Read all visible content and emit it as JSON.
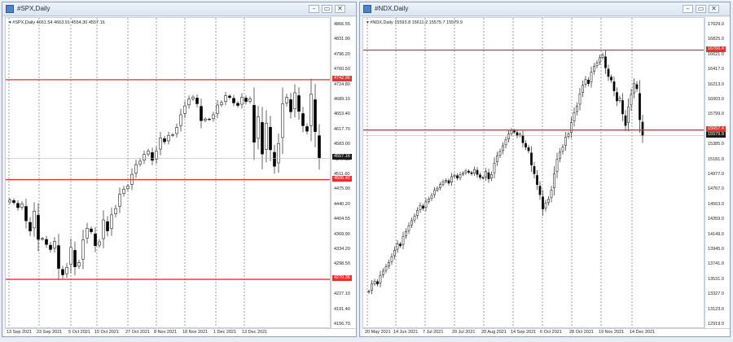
{
  "spx": {
    "title": "#SPX,Daily",
    "header": "▾ #SPX,Daily  4661.54 4663.91 4554.30 4557.16",
    "y_ticks": [
      "4866.55",
      "4831.90",
      "4796.20",
      "4760.50",
      "4724.80",
      "4689.10",
      "4653.40",
      "4617.70",
      "4583.00",
      "4547.30",
      "4511.60",
      "4475.90",
      "4440.20",
      "4404.55",
      "4369.90",
      "4334.20",
      "4298.50",
      "4262.80",
      "4227.10",
      "4191.40",
      "4156.70"
    ],
    "x_ticks": [
      "13 Sep 2021",
      "23 Sep 2021",
      "5 Oct 2021",
      "15 Oct 2021",
      "27 Oct 2021",
      "8 Nov 2021",
      "18 Nov 2021",
      "1 Dec 2021",
      "13 Dec 2021"
    ],
    "h_lines": [
      "4742.96",
      "4506.40",
      "4270.36"
    ],
    "current": "4557.16",
    "chart_data": {
      "type": "candlestick",
      "ylim": [
        4156.7,
        4870
      ],
      "close": [
        4458,
        4452,
        4440,
        4449,
        4409,
        4385,
        4432,
        4365,
        4367,
        4353,
        4341,
        4360,
        4296,
        4281,
        4299,
        4346,
        4300,
        4310,
        4364,
        4391,
        4383,
        4350,
        4359,
        4411,
        4385,
        4423,
        4438,
        4472,
        4484,
        4491,
        4519,
        4542,
        4550,
        4566,
        4574,
        4552,
        4574,
        4605,
        4596,
        4611,
        4613,
        4630,
        4660,
        4681,
        4697,
        4702,
        4686,
        4646,
        4650,
        4649,
        4660,
        4683,
        4689,
        4705,
        4701,
        4688,
        4682,
        4701,
        4691,
        4698,
        4595,
        4655,
        4567,
        4640,
        4577,
        4538,
        4592,
        4686,
        4701,
        4667,
        4712,
        4668,
        4634,
        4621,
        4709,
        4620,
        4557
      ],
      "h_lines": [
        4742.96,
        4506.4,
        4270.36
      ],
      "current": 4557.16
    }
  },
  "ndx": {
    "title": "#NDX,Daily",
    "header": "▾ #NDX,Daily  15593.8 15611.2 15575.7 15579.9",
    "y_ticks": [
      "17029.0",
      "16825.0",
      "16621.0",
      "16417.0",
      "16213.0",
      "16003.0",
      "15799.0",
      "15595.0",
      "15385.0",
      "15181.0",
      "14977.0",
      "14767.0",
      "14563.0",
      "14359.0",
      "14149.0",
      "13945.0",
      "13741.0",
      "13531.0",
      "13327.0",
      "13123.0",
      "12919.0"
    ],
    "x_ticks": [
      "20 May 2021",
      "14 Jun 2021",
      "7 Jul 2021",
      "29 Jul 2021",
      "20 Aug 2021",
      "14 Sep 2021",
      "6 Oct 2021",
      "28 Oct 2021",
      "19 Nov 2021",
      "14 Dec 2021"
    ],
    "h_lines": [
      "16766.4",
      "15657.4"
    ],
    "current": "15579.9",
    "chart_data": {
      "type": "candlestick",
      "ylim": [
        12919,
        17100
      ],
      "close": [
        13420,
        13520,
        13560,
        13520,
        13640,
        13700,
        13760,
        13820,
        13900,
        13990,
        14080,
        14050,
        14180,
        14250,
        14330,
        14400,
        14460,
        14540,
        14610,
        14570,
        14660,
        14700,
        14750,
        14820,
        14850,
        14900,
        14940,
        14960,
        14920,
        15010,
        15030,
        14990,
        15040,
        15060,
        15090,
        15070,
        15050,
        15110,
        15040,
        15000,
        14990,
        15080,
        14980,
        15040,
        15200,
        15300,
        15360,
        15440,
        15520,
        15600,
        15650,
        15630,
        15580,
        15600,
        15480,
        15420,
        15370,
        15170,
        15050,
        14900,
        14760,
        14560,
        14640,
        14700,
        14820,
        15050,
        15250,
        15350,
        15420,
        15560,
        15600,
        15760,
        15900,
        15990,
        16160,
        16280,
        16360,
        16300,
        16460,
        16540,
        16590,
        16660,
        16700,
        16520,
        16400,
        16350,
        16200,
        16060,
        16100,
        15880,
        15720,
        15980,
        16150,
        16300,
        16230,
        15800,
        15579.9
      ],
      "h_lines": [
        16766.4,
        15657.4
      ],
      "current": 15579.9
    }
  },
  "colors": {
    "line": "#e8302d",
    "bull": "#ffffff",
    "bear": "#000000",
    "grid": "#5a5a5a"
  }
}
